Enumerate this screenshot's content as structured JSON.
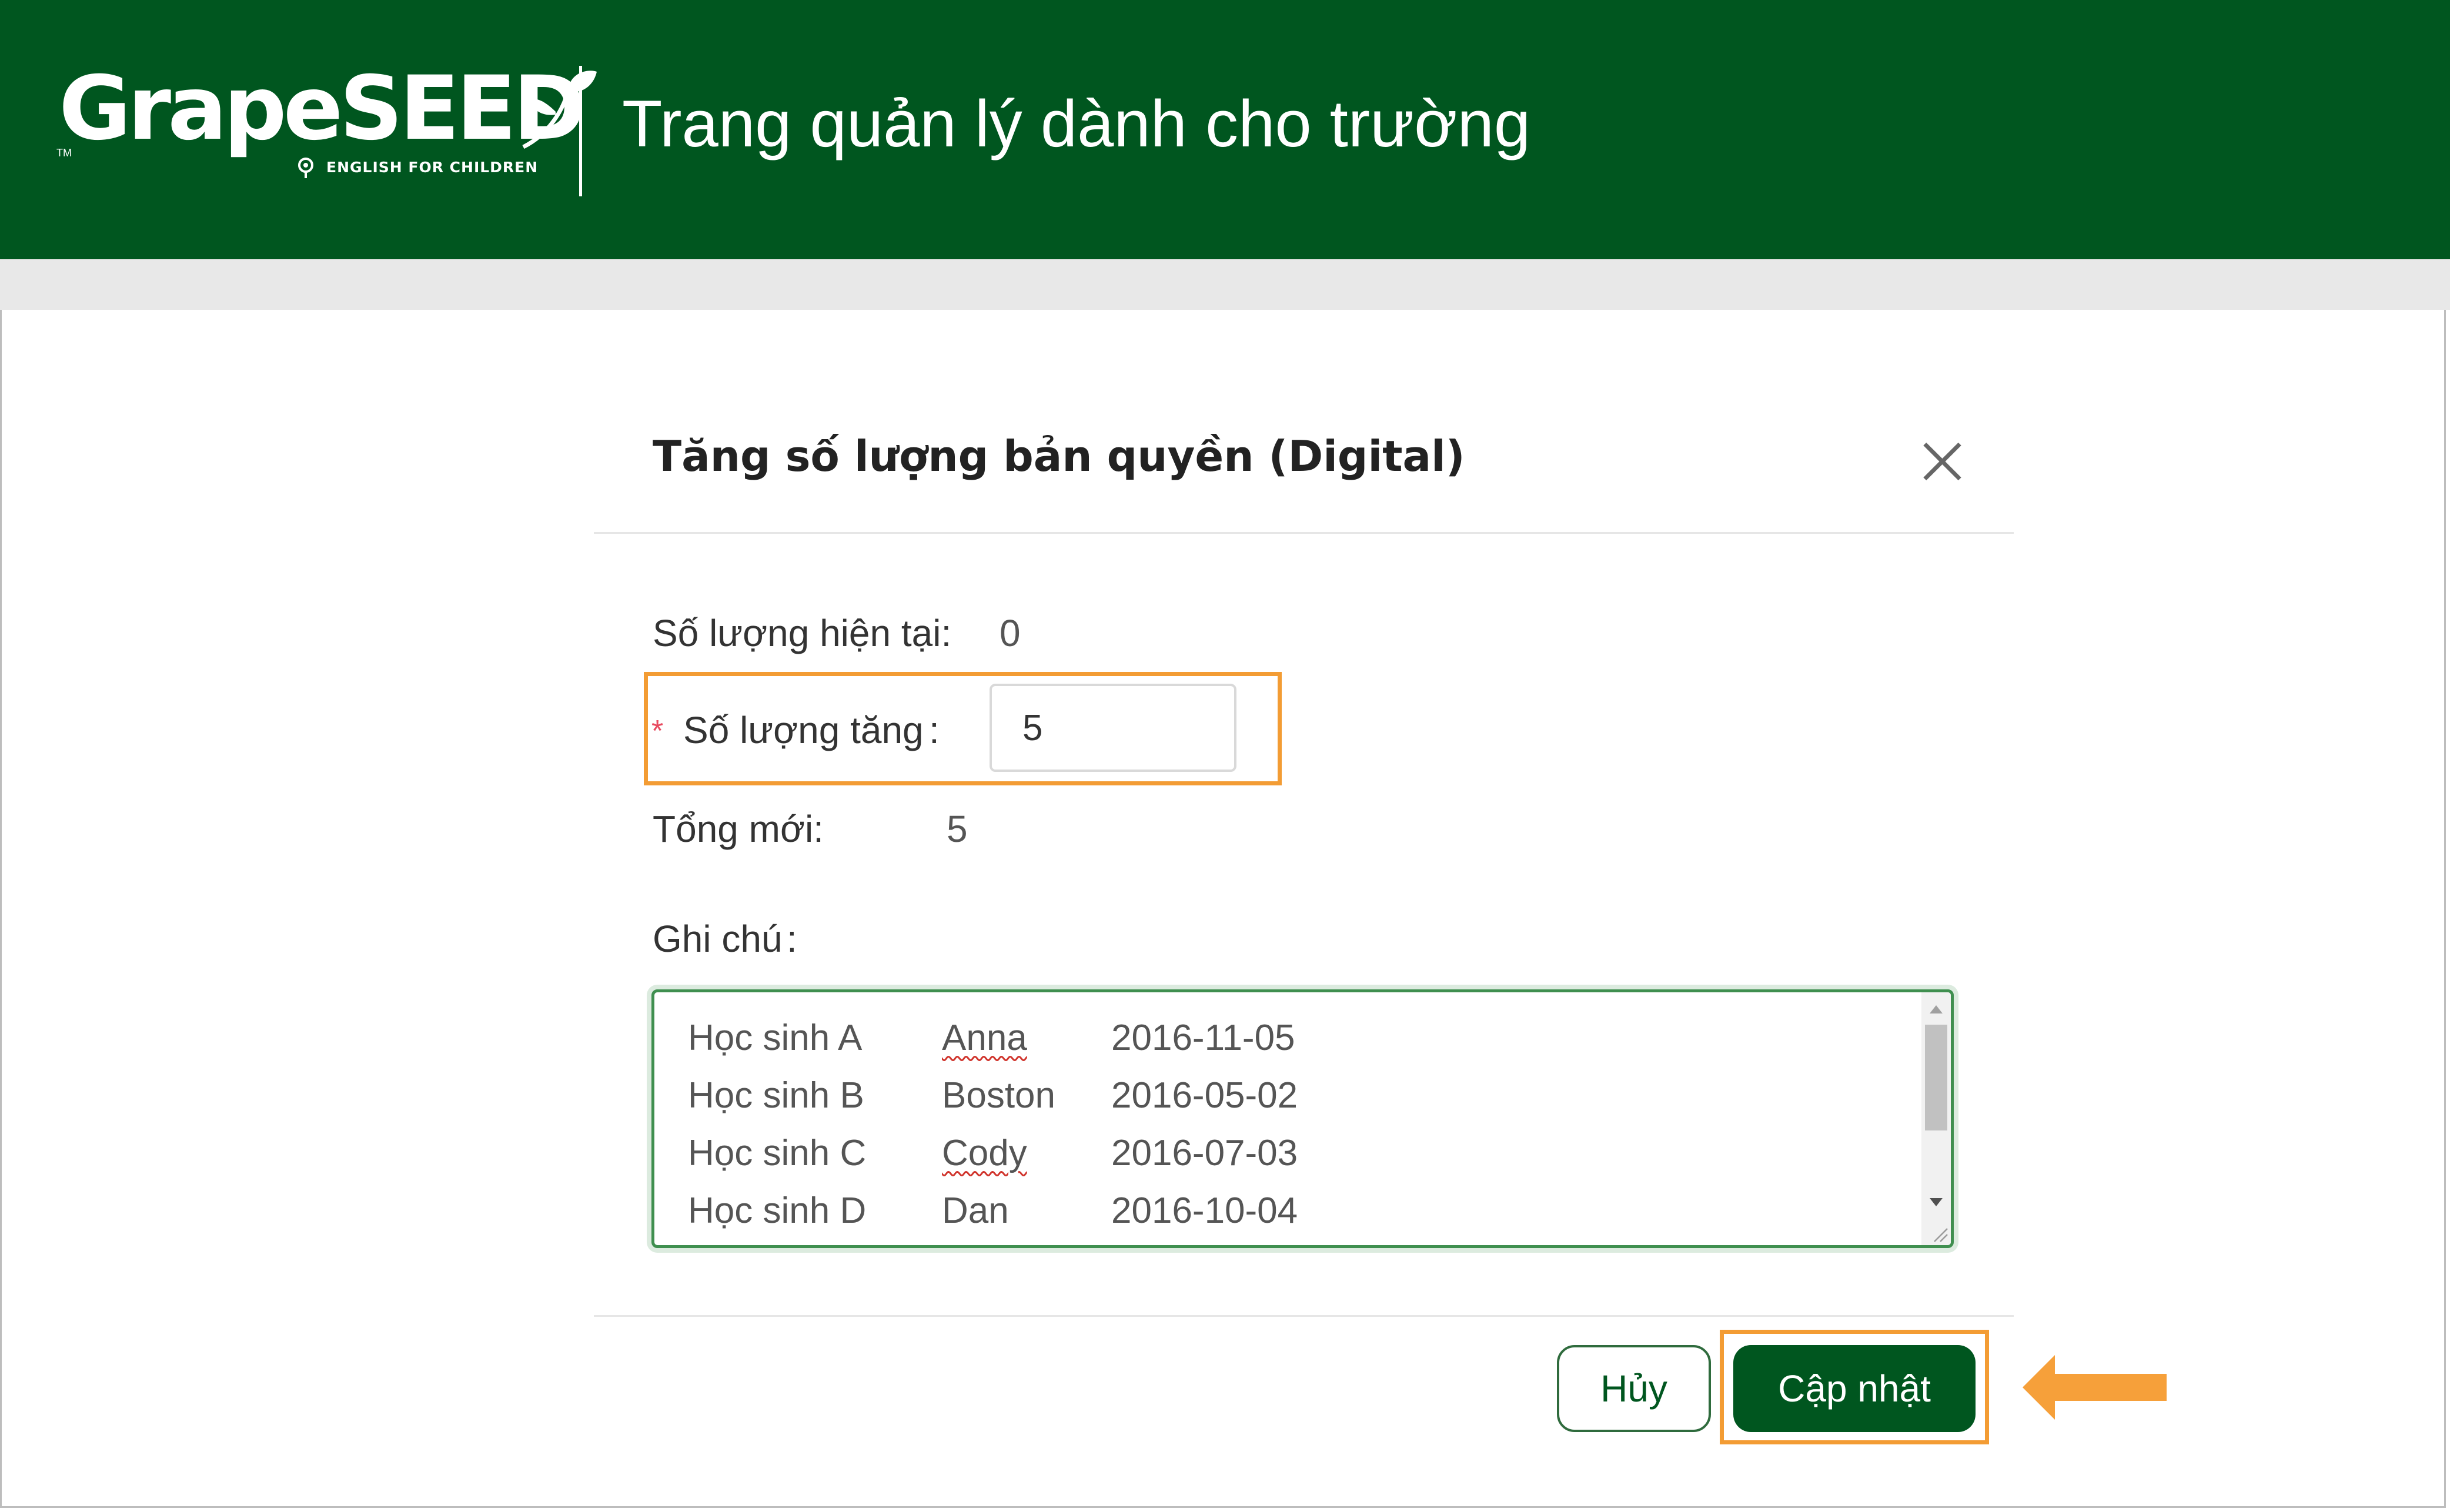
{
  "header": {
    "logo_text": "GrapeSEED",
    "logo_tagline": "ENGLISH FOR CHILDREN",
    "logo_tm": "TM",
    "title": "Trang quản lý dành cho trường"
  },
  "modal": {
    "title": "Tăng số lượng bản quyền (Digital)",
    "current_label": "Số lượng hiện tại:",
    "current_value": "0",
    "required_mark": "*",
    "increase_label": "Số lượng tăng",
    "label_colon": ":",
    "increase_value": "5",
    "new_total_label": "Tổng mới:",
    "new_total_value": "5",
    "note_label": "Ghi chú",
    "notes": [
      {
        "student": "Học sinh A",
        "name": "Anna",
        "date": "2016-11-05"
      },
      {
        "student": "Học sinh B",
        "name": "Boston",
        "date": "2016-05-02"
      },
      {
        "student": "Học sinh C",
        "name": "Cody",
        "date": "2016-07-03"
      },
      {
        "student": "Học sinh D",
        "name": "Dan",
        "date": "2016-10-04"
      }
    ],
    "cancel_label": "Hủy",
    "update_label": "Cập nhật"
  },
  "colors": {
    "brand_green": "#00561f",
    "highlight_orange": "#f39c34",
    "required_red": "#e84a5f"
  },
  "icons": [
    "close-icon",
    "arrow-left-icon",
    "leaf-icon",
    "scroll-up-icon",
    "scroll-down-icon",
    "resize-grip-icon"
  ]
}
